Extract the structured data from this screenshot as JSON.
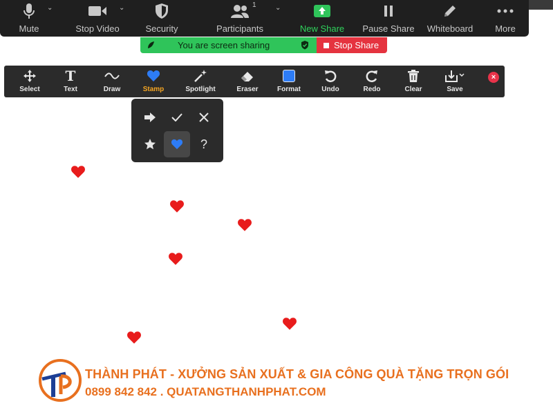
{
  "toolbar": {
    "mute_label": "Mute",
    "stop_video_label": "Stop Video",
    "security_label": "Security",
    "participants_label": "Participants",
    "participants_count": "1",
    "new_share_label": "New Share",
    "pause_share_label": "Pause Share",
    "whiteboard_label": "Whiteboard",
    "more_label": "More"
  },
  "share_banner": {
    "status_text": "You are screen sharing",
    "stop_label": "Stop Share"
  },
  "annotate": {
    "tools": {
      "select": "Select",
      "text": "Text",
      "draw": "Draw",
      "stamp": "Stamp",
      "spotlight": "Spotlight",
      "eraser": "Eraser",
      "format": "Format",
      "undo": "Undo",
      "redo": "Redo",
      "clear": "Clear",
      "save": "Save"
    },
    "active_tool": "Stamp",
    "text_icon_glyph": "T",
    "close_glyph": "×",
    "stamp_options": {
      "arrow": "arrow-icon",
      "check": "check-icon",
      "x": "x-icon",
      "star": "star-icon",
      "heart": "heart-icon",
      "question": "?"
    },
    "selected_stamp": "heart-icon"
  },
  "colors": {
    "toolbar_bg": "#1f1f1f",
    "share_green": "#2fc45a",
    "stop_red": "#e5333f",
    "stamp_blue": "#2d7cf6",
    "heart_red": "#e81c1c",
    "watermark_orange": "#e8701f",
    "watermark_blue": "#1c3f95"
  },
  "watermark": {
    "line1": "THÀNH PHÁT - XƯỞNG SẢN XUẤT & GIA CÔNG QUÀ TẶNG TRỌN GÓI",
    "line2": "0899 842 842 . QUATANGTHANHPHAT.COM",
    "logo_text": "TP"
  }
}
